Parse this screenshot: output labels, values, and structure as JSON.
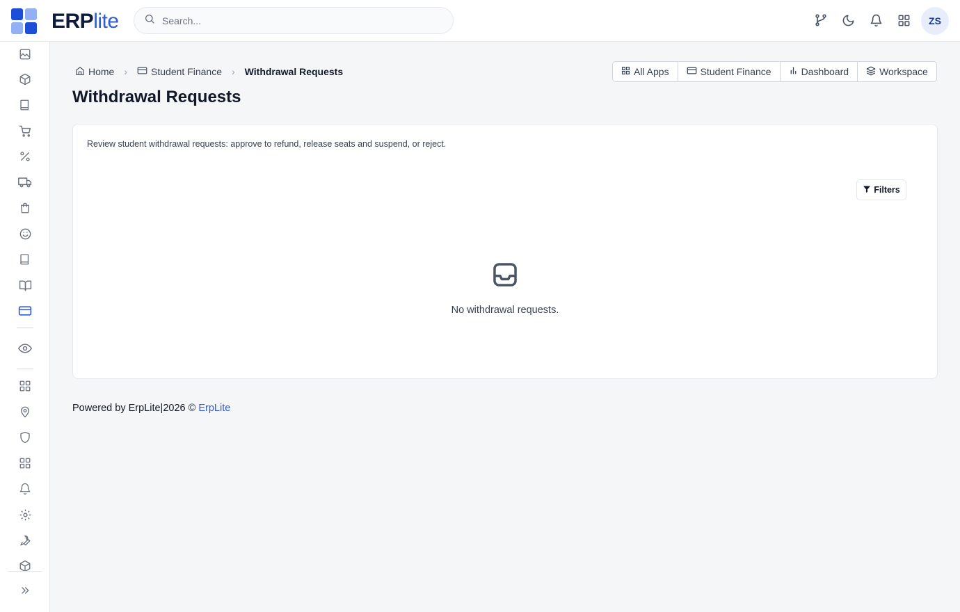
{
  "brand": {
    "logo_erp": "ERP",
    "logo_lite": "lite",
    "colors": {
      "dark": "#0f1b3d",
      "accent": "#2f5bd6",
      "light_square": "#93b0f5",
      "primary_square": "#1d4ed8"
    }
  },
  "search": {
    "placeholder": "Search..."
  },
  "topbar": {
    "icons": [
      "git-branch-icon",
      "moon-icon",
      "bell-icon",
      "apps-grid-icon"
    ],
    "avatar_initials": "ZS"
  },
  "sidebar": {
    "items": [
      "image-icon",
      "box-icon",
      "book-icon",
      "cart-icon",
      "percent-icon",
      "truck-icon",
      "bag-icon",
      "smile-icon",
      "notebook-icon",
      "book-open-icon",
      "credit-card-icon",
      "eye-icon",
      "grid-icon",
      "map-pin-icon",
      "shield-icon",
      "grid-icon-2",
      "bell-icon",
      "settings-icon",
      "wrench-icon",
      "package-icon",
      "expand-icon"
    ],
    "active": "credit-card-icon"
  },
  "breadcrumb": {
    "home": "Home",
    "section": "Student Finance",
    "current": "Withdrawal Requests"
  },
  "page": {
    "title": "Withdrawal Requests"
  },
  "quicklinks": {
    "all_apps": "All Apps",
    "student_finance": "Student Finance",
    "dashboard": "Dashboard",
    "workspace": "Workspace"
  },
  "card": {
    "description": "Review student withdrawal requests: approve to refund, release seats and suspend, or reject.",
    "filters_label": "Filters",
    "empty_message": "No withdrawal requests."
  },
  "footer": {
    "powered_by": "Powered by ErpLite",
    "separator": "|",
    "year": "2026 ©",
    "link": "ErpLite"
  }
}
